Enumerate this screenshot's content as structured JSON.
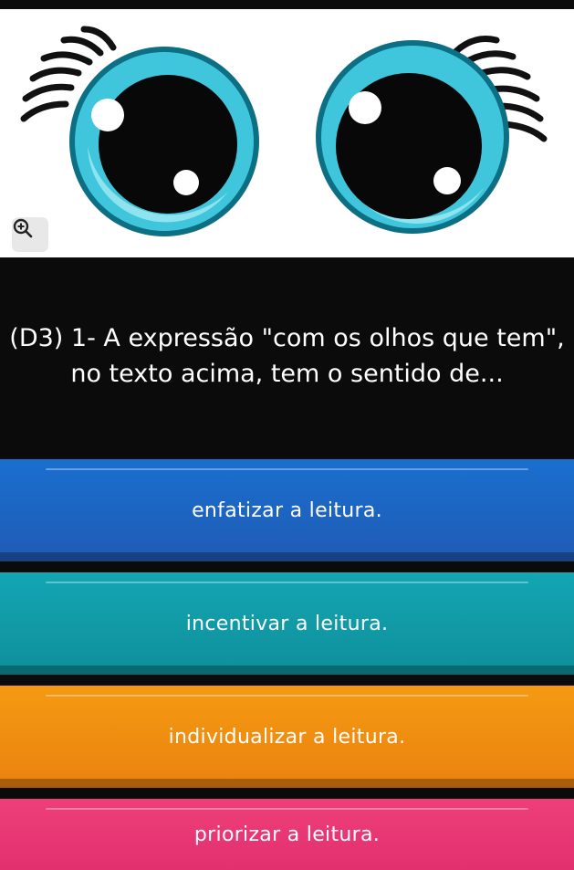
{
  "question": {
    "image_alt": "cartoon eyes",
    "zoom_icon": "zoom-in-icon",
    "text": "(D3) 1- A expressão \"com os olhos que tem\", no texto acima, tem o sentido de..."
  },
  "options": [
    {
      "label": "enfatizar a leitura.",
      "color": "#1f63c0"
    },
    {
      "label": "incentivar a leitura.",
      "color": "#129ba7"
    },
    {
      "label": "individualizar a leitura.",
      "color": "#ef8e11"
    },
    {
      "label": "priorizar a leitura.",
      "color": "#e83873"
    }
  ],
  "colors": {
    "background": "#0b0b0b",
    "iris": "#3fc6dc",
    "iris_light": "#8fe3ee",
    "iris_outline": "#0c6f83"
  }
}
